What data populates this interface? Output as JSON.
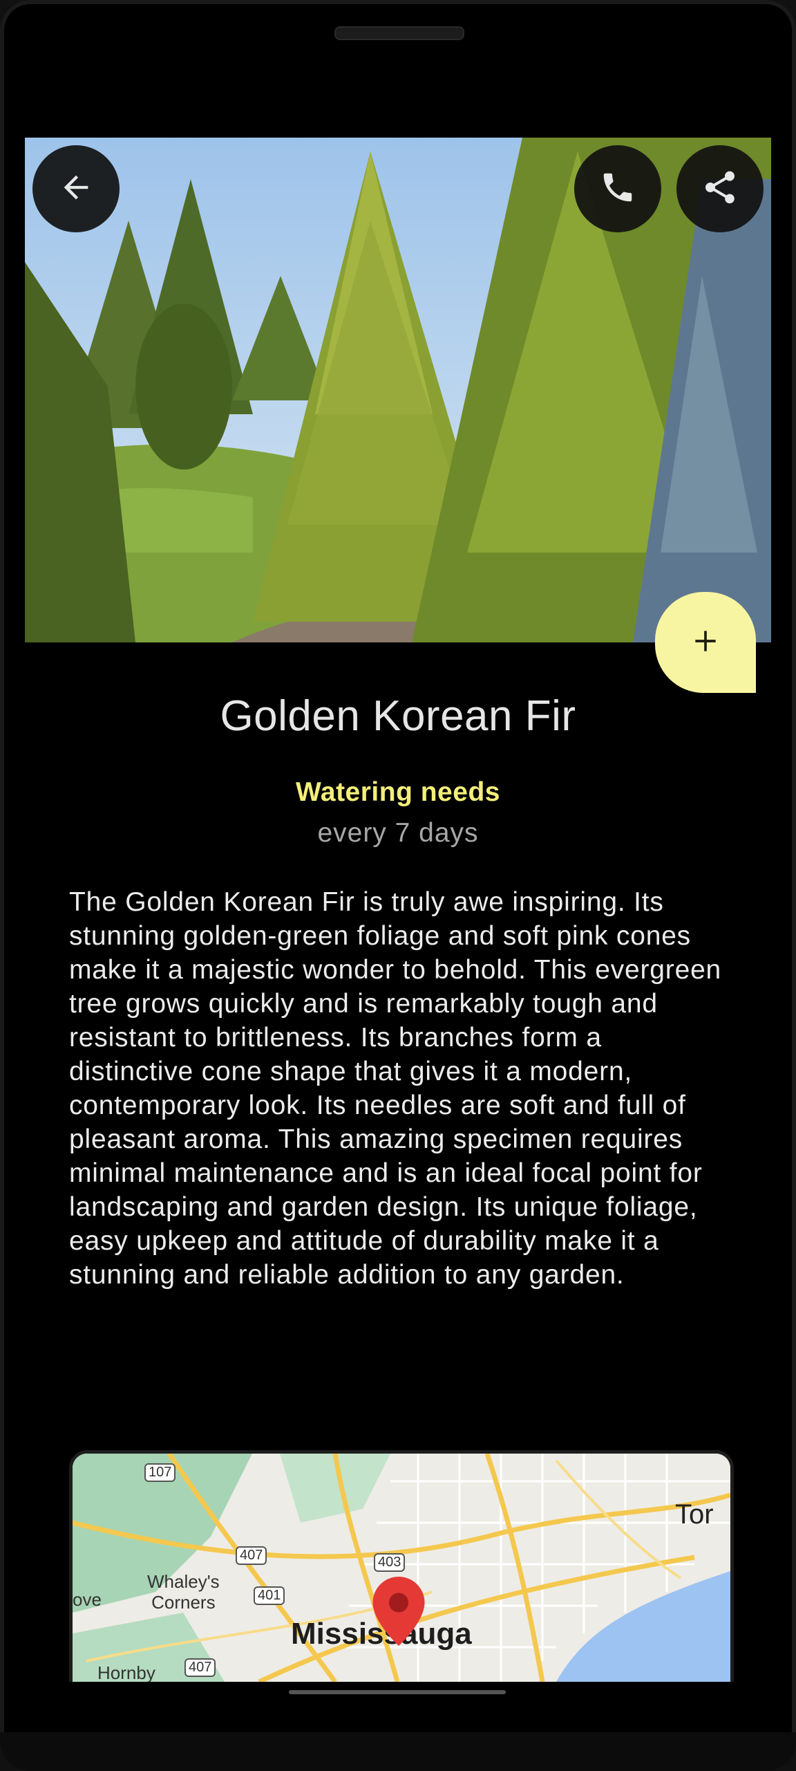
{
  "header": {
    "back_icon": "arrow-back-icon",
    "call_icon": "phone-icon",
    "share_icon": "share-icon"
  },
  "fab": {
    "icon": "plus-icon",
    "label": "+"
  },
  "plant": {
    "name": "Golden Korean Fir",
    "watering_label": "Watering needs",
    "watering_value": "every 7 days",
    "description": "The Golden Korean Fir is truly awe inspiring. Its stunning golden-green foliage and soft pink cones make it a majestic wonder to behold. This evergreen tree grows quickly and is remarkably tough and resistant to brittleness. Its branches form a distinctive cone shape that gives it a modern, contemporary look. Its needles are soft and full of pleasant aroma. This amazing specimen requires minimal maintenance and is an ideal focal point for landscaping and garden design. Its unique foliage, easy upkeep and attitude of durability make it a stunning and reliable addition to any garden."
  },
  "map": {
    "city": "Mississauga",
    "labels": {
      "toronto_partial": "Tor",
      "whaleys_line1": "Whaley's",
      "whaleys_line2": "Corners",
      "grove_partial": "ove",
      "hornby": "Hornby"
    },
    "shields": {
      "r107": "107",
      "r407a": "407",
      "r401": "401",
      "r403": "403",
      "r407b": "407"
    },
    "pin_icon": "map-pin-icon"
  },
  "colors": {
    "accent": "#f3ee7a",
    "fab": "#f8f5a2",
    "background": "#000000"
  }
}
